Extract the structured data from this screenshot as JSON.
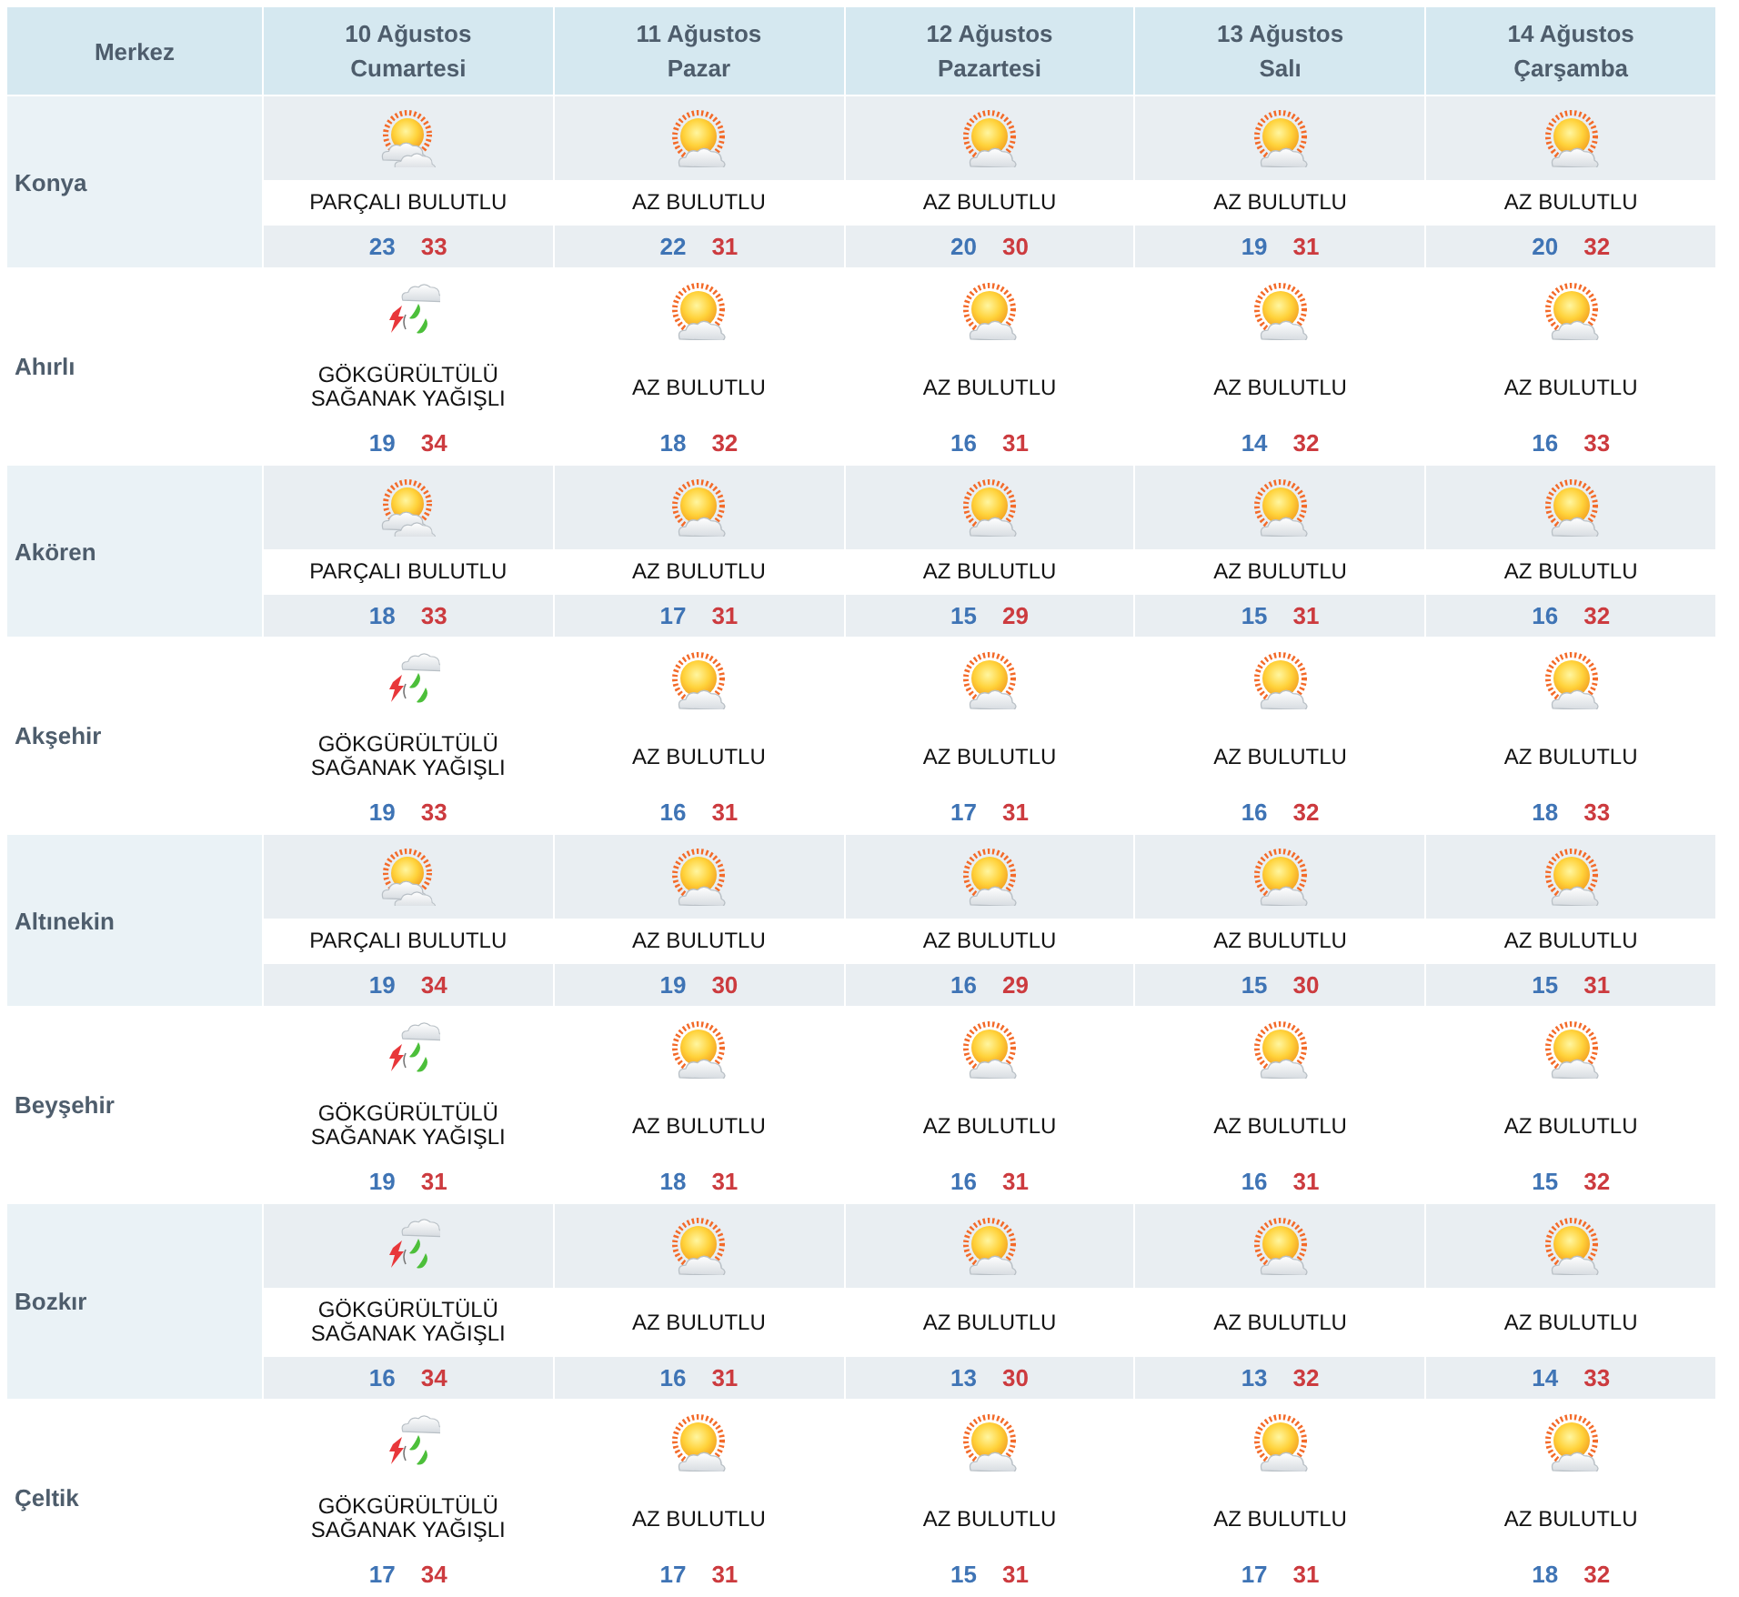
{
  "header": {
    "corner": "Merkez",
    "days": [
      {
        "date": "10 Ağustos",
        "weekday": "Cumartesi"
      },
      {
        "date": "11 Ağustos",
        "weekday": "Pazar"
      },
      {
        "date": "12 Ağustos",
        "weekday": "Pazartesi"
      },
      {
        "date": "13 Ağustos",
        "weekday": "Salı"
      },
      {
        "date": "14 Ağustos",
        "weekday": "Çarşamba"
      }
    ]
  },
  "rows": [
    {
      "city": "Konya",
      "days": [
        {
          "kind": "partly",
          "condition": "PARÇALI BULUTLU",
          "low": "23",
          "high": "33"
        },
        {
          "kind": "sunny",
          "condition": "AZ BULUTLU",
          "low": "22",
          "high": "31"
        },
        {
          "kind": "sunny",
          "condition": "AZ BULUTLU",
          "low": "20",
          "high": "30"
        },
        {
          "kind": "sunny",
          "condition": "AZ BULUTLU",
          "low": "19",
          "high": "31"
        },
        {
          "kind": "sunny",
          "condition": "AZ BULUTLU",
          "low": "20",
          "high": "32"
        }
      ]
    },
    {
      "city": "Ahırlı",
      "days": [
        {
          "kind": "storm",
          "condition": "GÖKGÜRÜLTÜLÜ SAĞANAK YAĞIŞLI",
          "low": "19",
          "high": "34"
        },
        {
          "kind": "sunny",
          "condition": "AZ BULUTLU",
          "low": "18",
          "high": "32"
        },
        {
          "kind": "sunny",
          "condition": "AZ BULUTLU",
          "low": "16",
          "high": "31"
        },
        {
          "kind": "sunny",
          "condition": "AZ BULUTLU",
          "low": "14",
          "high": "32"
        },
        {
          "kind": "sunny",
          "condition": "AZ BULUTLU",
          "low": "16",
          "high": "33"
        }
      ]
    },
    {
      "city": "Akören",
      "days": [
        {
          "kind": "partly",
          "condition": "PARÇALI BULUTLU",
          "low": "18",
          "high": "33"
        },
        {
          "kind": "sunny",
          "condition": "AZ BULUTLU",
          "low": "17",
          "high": "31"
        },
        {
          "kind": "sunny",
          "condition": "AZ BULUTLU",
          "low": "15",
          "high": "29"
        },
        {
          "kind": "sunny",
          "condition": "AZ BULUTLU",
          "low": "15",
          "high": "31"
        },
        {
          "kind": "sunny",
          "condition": "AZ BULUTLU",
          "low": "16",
          "high": "32"
        }
      ]
    },
    {
      "city": "Akşehir",
      "days": [
        {
          "kind": "storm",
          "condition": "GÖKGÜRÜLTÜLÜ SAĞANAK YAĞIŞLI",
          "low": "19",
          "high": "33"
        },
        {
          "kind": "sunny",
          "condition": "AZ BULUTLU",
          "low": "16",
          "high": "31"
        },
        {
          "kind": "sunny",
          "condition": "AZ BULUTLU",
          "low": "17",
          "high": "31"
        },
        {
          "kind": "sunny",
          "condition": "AZ BULUTLU",
          "low": "16",
          "high": "32"
        },
        {
          "kind": "sunny",
          "condition": "AZ BULUTLU",
          "low": "18",
          "high": "33"
        }
      ]
    },
    {
      "city": "Altınekin",
      "days": [
        {
          "kind": "partly",
          "condition": "PARÇALI BULUTLU",
          "low": "19",
          "high": "34"
        },
        {
          "kind": "sunny",
          "condition": "AZ BULUTLU",
          "low": "19",
          "high": "30"
        },
        {
          "kind": "sunny",
          "condition": "AZ BULUTLU",
          "low": "16",
          "high": "29"
        },
        {
          "kind": "sunny",
          "condition": "AZ BULUTLU",
          "low": "15",
          "high": "30"
        },
        {
          "kind": "sunny",
          "condition": "AZ BULUTLU",
          "low": "15",
          "high": "31"
        }
      ]
    },
    {
      "city": "Beyşehir",
      "days": [
        {
          "kind": "storm",
          "condition": "GÖKGÜRÜLTÜLÜ SAĞANAK YAĞIŞLI",
          "low": "19",
          "high": "31"
        },
        {
          "kind": "sunny",
          "condition": "AZ BULUTLU",
          "low": "18",
          "high": "31"
        },
        {
          "kind": "sunny",
          "condition": "AZ BULUTLU",
          "low": "16",
          "high": "31"
        },
        {
          "kind": "sunny",
          "condition": "AZ BULUTLU",
          "low": "16",
          "high": "31"
        },
        {
          "kind": "sunny",
          "condition": "AZ BULUTLU",
          "low": "15",
          "high": "32"
        }
      ]
    },
    {
      "city": "Bozkır",
      "days": [
        {
          "kind": "storm",
          "condition": "GÖKGÜRÜLTÜLÜ SAĞANAK YAĞIŞLI",
          "low": "16",
          "high": "34"
        },
        {
          "kind": "sunny",
          "condition": "AZ BULUTLU",
          "low": "16",
          "high": "31"
        },
        {
          "kind": "sunny",
          "condition": "AZ BULUTLU",
          "low": "13",
          "high": "30"
        },
        {
          "kind": "sunny",
          "condition": "AZ BULUTLU",
          "low": "13",
          "high": "32"
        },
        {
          "kind": "sunny",
          "condition": "AZ BULUTLU",
          "low": "14",
          "high": "33"
        }
      ]
    },
    {
      "city": "Çeltik",
      "days": [
        {
          "kind": "storm",
          "condition": "GÖKGÜRÜLTÜLÜ SAĞANAK YAĞIŞLI",
          "low": "17",
          "high": "34"
        },
        {
          "kind": "sunny",
          "condition": "AZ BULUTLU",
          "low": "17",
          "high": "31"
        },
        {
          "kind": "sunny",
          "condition": "AZ BULUTLU",
          "low": "15",
          "high": "31"
        },
        {
          "kind": "sunny",
          "condition": "AZ BULUTLU",
          "low": "17",
          "high": "31"
        },
        {
          "kind": "sunny",
          "condition": "AZ BULUTLU",
          "low": "18",
          "high": "32"
        }
      ]
    }
  ]
}
